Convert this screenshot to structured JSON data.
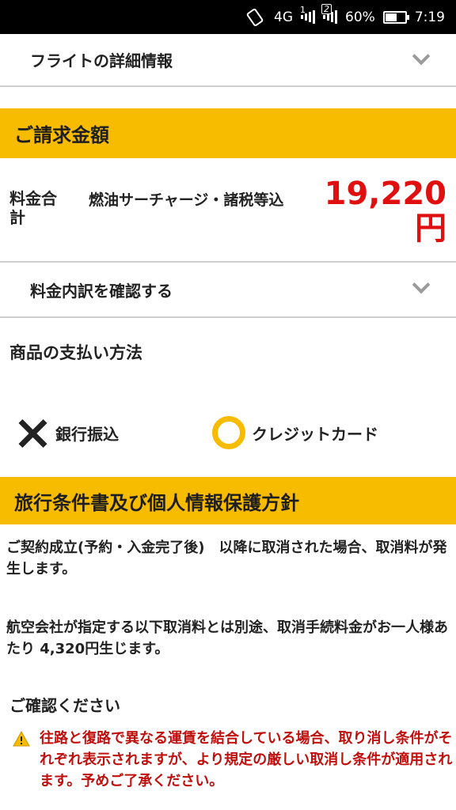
{
  "status_bar": {
    "network": "4G",
    "sim1": "1",
    "sim2": "2",
    "battery": "60%",
    "battery_level": 0.6,
    "time": "7:19"
  },
  "flight_details": {
    "label": "フライトの詳細情報"
  },
  "billing": {
    "header": "ご請求金額",
    "total_label": "料金合計",
    "note": "燃油サーチャージ・諸税等込",
    "amount": "19,220円",
    "amount_color": "#e01010"
  },
  "fee_breakdown": {
    "label": "料金内訳を確認する"
  },
  "payment": {
    "title": "商品の支払い方法",
    "options": [
      {
        "label": "銀行振込",
        "status": "unavailable",
        "icon": "cross-icon"
      },
      {
        "label": "クレジットカード",
        "status": "available",
        "icon": "circle-icon"
      }
    ]
  },
  "terms": {
    "header": "旅行条件書及び個人情報保護方針",
    "para1": "ご契約成立(予約・入金完了後)　以降に取消された場合、取消料が発生します。",
    "para2": "航空会社が指定する以下取消料とは別途、取消手続料金がお一人様あたり 4,320円生じます。"
  },
  "confirm": {
    "title": "ご確認ください",
    "warning": "往路と復路で異なる運賃を結合している場合、取り消し条件がそれぞれ表示されますが、より規定の厳しい取消し条件が適用されます。予めご了承ください。",
    "warning_color": "#c0100e"
  },
  "colors": {
    "accent": "#f7bb00",
    "statusbar": "#000000"
  }
}
